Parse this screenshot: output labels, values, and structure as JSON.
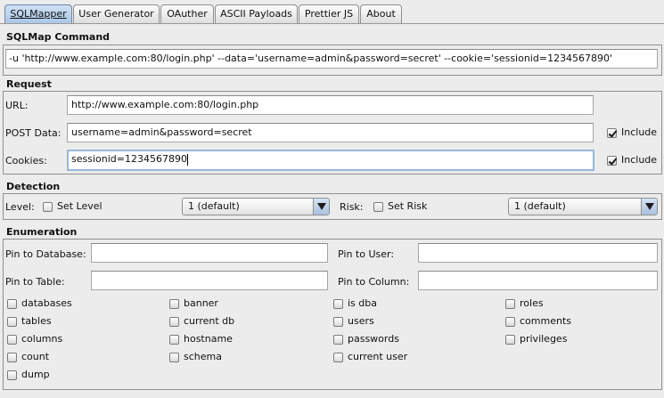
{
  "tabs": [
    {
      "label": "SQLMapper",
      "active": true
    },
    {
      "label": "User Generator",
      "active": false
    },
    {
      "label": "OAuther",
      "active": false
    },
    {
      "label": "ASCII Payloads",
      "active": false
    },
    {
      "label": "Prettier JS",
      "active": false
    },
    {
      "label": "About",
      "active": false
    }
  ],
  "sqlmap": {
    "title": "SQLMap Command",
    "command": "-u 'http://www.example.com:80/login.php' --data='username=admin&password=secret' --cookie='sessionid=1234567890'"
  },
  "request": {
    "title": "Request",
    "url_label": "URL:",
    "url_value": "http://www.example.com:80/login.php",
    "post_label": "POST Data:",
    "post_value": "username=admin&password=secret",
    "post_include_label": "Include",
    "post_include_checked": true,
    "cookies_label": "Cookies:",
    "cookies_value": "sessionid=1234567890",
    "cookies_include_label": "Include",
    "cookies_include_checked": true
  },
  "detection": {
    "title": "Detection",
    "level_label": "Level:",
    "set_level_label": "Set Level",
    "level_value": "1 (default)",
    "risk_label": "Risk:",
    "set_risk_label": "Set Risk",
    "risk_value": "1 (default)"
  },
  "enumeration": {
    "title": "Enumeration",
    "pin_database_label": "Pin to Database:",
    "pin_user_label": "Pin to User:",
    "pin_table_label": "Pin to Table:",
    "pin_column_label": "Pin to Column:",
    "pin_database_value": "",
    "pin_user_value": "",
    "pin_table_value": "",
    "pin_column_value": "",
    "options": [
      [
        "databases",
        "tables",
        "columns",
        "count",
        "dump"
      ],
      [
        "banner",
        "current db",
        "hostname",
        "schema"
      ],
      [
        "is dba",
        "users",
        "passwords",
        "current user"
      ],
      [
        "roles",
        "comments",
        "privileges"
      ]
    ]
  }
}
